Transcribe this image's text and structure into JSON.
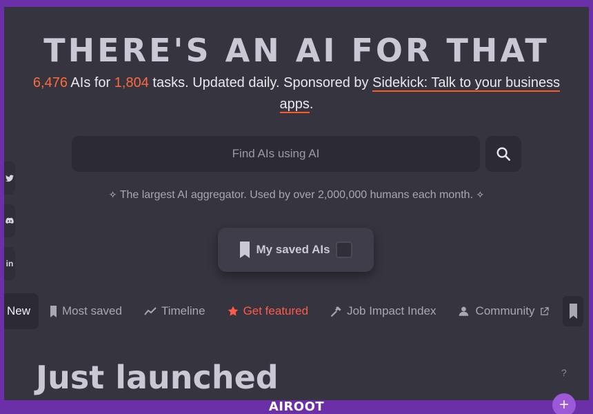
{
  "hero": {
    "title": "THERE'S AN AI FOR THAT",
    "ais_count": "6,476",
    "ais_text": " AIs for ",
    "tasks_count": "1,804",
    "tasks_text": " tasks. Updated daily. Sponsored by ",
    "sponsor_link": "Sidekick: Talk to your business apps",
    "period": "."
  },
  "search": {
    "placeholder": "Find AIs using AI",
    "button_icon": "search-icon"
  },
  "tagline": {
    "text": "The largest AI aggregator. Used by over 2,000,000 humans each month.",
    "sparkle_left": "✧",
    "sparkle_right": "✧"
  },
  "saved": {
    "label": "My saved AIs"
  },
  "social": {
    "twitter": "twitter-icon",
    "discord": "discord-icon",
    "linkedin_label": "in"
  },
  "nav": {
    "items": [
      {
        "label": "New"
      },
      {
        "label": "Most saved"
      },
      {
        "label": "Timeline"
      },
      {
        "label": "Get featured"
      },
      {
        "label": "Job Impact Index"
      },
      {
        "label": "Community"
      }
    ]
  },
  "section": {
    "title": "Just launched",
    "help": "?"
  },
  "branding": {
    "watermark": "AIROOT",
    "fab": "+"
  },
  "colors": {
    "background": "#35343f",
    "accent_orange": "#ff6a3d",
    "featured_red": "#ff5a4a",
    "frame_purple": "#6b2fa8"
  }
}
